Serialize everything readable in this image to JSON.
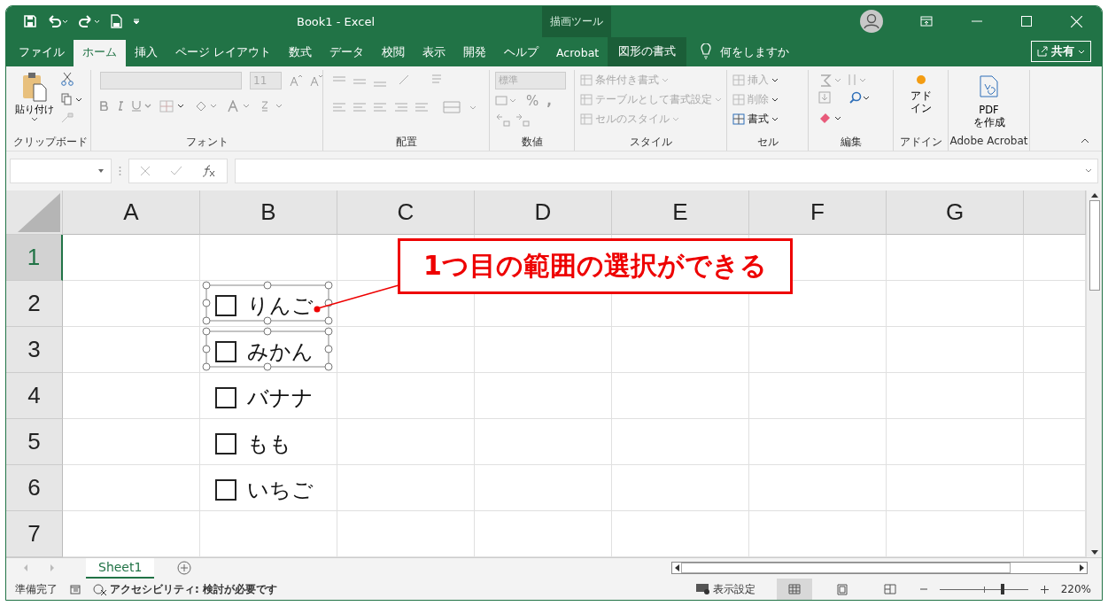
{
  "window": {
    "title": "Book1  -  Excel",
    "context_label": "描画ツール"
  },
  "tabs": [
    {
      "label": "ファイル",
      "selected": false
    },
    {
      "label": "ホーム",
      "selected": true
    },
    {
      "label": "挿入",
      "selected": false
    },
    {
      "label": "ページ レイアウト",
      "selected": false
    },
    {
      "label": "数式",
      "selected": false
    },
    {
      "label": "データ",
      "selected": false
    },
    {
      "label": "校閲",
      "selected": false
    },
    {
      "label": "表示",
      "selected": false
    },
    {
      "label": "開発",
      "selected": false
    },
    {
      "label": "ヘルプ",
      "selected": false
    },
    {
      "label": "Acrobat",
      "selected": false
    }
  ],
  "context_tab": {
    "label": "図形の書式"
  },
  "tell_me": {
    "placeholder": "何をしますか"
  },
  "share_button": {
    "label": "共有"
  },
  "ribbon": {
    "paste": {
      "label": "貼り付け"
    },
    "font_size": {
      "value": "11"
    },
    "number_format": {
      "value": "標準"
    },
    "percent": "%",
    "comma": ",",
    "styles": [
      {
        "label": "条件付き書式",
        "disabled": true
      },
      {
        "label": "テーブルとして書式設定",
        "disabled": true
      },
      {
        "label": "セルのスタイル",
        "disabled": true
      }
    ],
    "cells": [
      {
        "label": "挿入",
        "disabled": true
      },
      {
        "label": "削除",
        "disabled": true
      },
      {
        "label": "書式",
        "disabled": false
      }
    ],
    "addin": {
      "lines": [
        "アド",
        "イン"
      ]
    },
    "pdf": {
      "lines": [
        "PDF",
        "を作成"
      ]
    },
    "groups": [
      "クリップボード",
      "フォント",
      "配置",
      "数値",
      "スタイル",
      "セル",
      "編集",
      "アドイン",
      "Adobe Acrobat"
    ]
  },
  "sheet": {
    "columns": [
      "A",
      "B",
      "C",
      "D",
      "E",
      "F",
      "G"
    ],
    "rows": [
      {
        "header": "1",
        "selected": true,
        "checkbox": null
      },
      {
        "header": "2",
        "selected": false,
        "checkbox": {
          "label": "りんご",
          "checked": false,
          "selected": true
        }
      },
      {
        "header": "3",
        "selected": false,
        "checkbox": {
          "label": "みかん",
          "checked": false,
          "selected": true
        }
      },
      {
        "header": "4",
        "selected": false,
        "checkbox": {
          "label": "バナナ",
          "checked": false,
          "selected": false
        }
      },
      {
        "header": "5",
        "selected": false,
        "checkbox": {
          "label": "もも",
          "checked": false,
          "selected": false
        }
      },
      {
        "header": "6",
        "selected": false,
        "checkbox": {
          "label": "いちご",
          "checked": false,
          "selected": false
        }
      },
      {
        "header": "7",
        "selected": false,
        "checkbox": null
      }
    ]
  },
  "callout": {
    "text": "1つ目の範囲の選択ができる"
  },
  "sheet_tabs": [
    {
      "label": "Sheet1",
      "selected": true
    }
  ],
  "status_bar": {
    "ready": "準備完了",
    "accessibility": "アクセシビリティ: 検討が必要です",
    "display_settings": "表示設定",
    "views": [
      {
        "kind": "normal",
        "selected": true
      },
      {
        "kind": "layout",
        "selected": false
      },
      {
        "kind": "pagebreak",
        "selected": false
      }
    ],
    "zoom": {
      "level": 0.71,
      "reading": "220%"
    }
  }
}
